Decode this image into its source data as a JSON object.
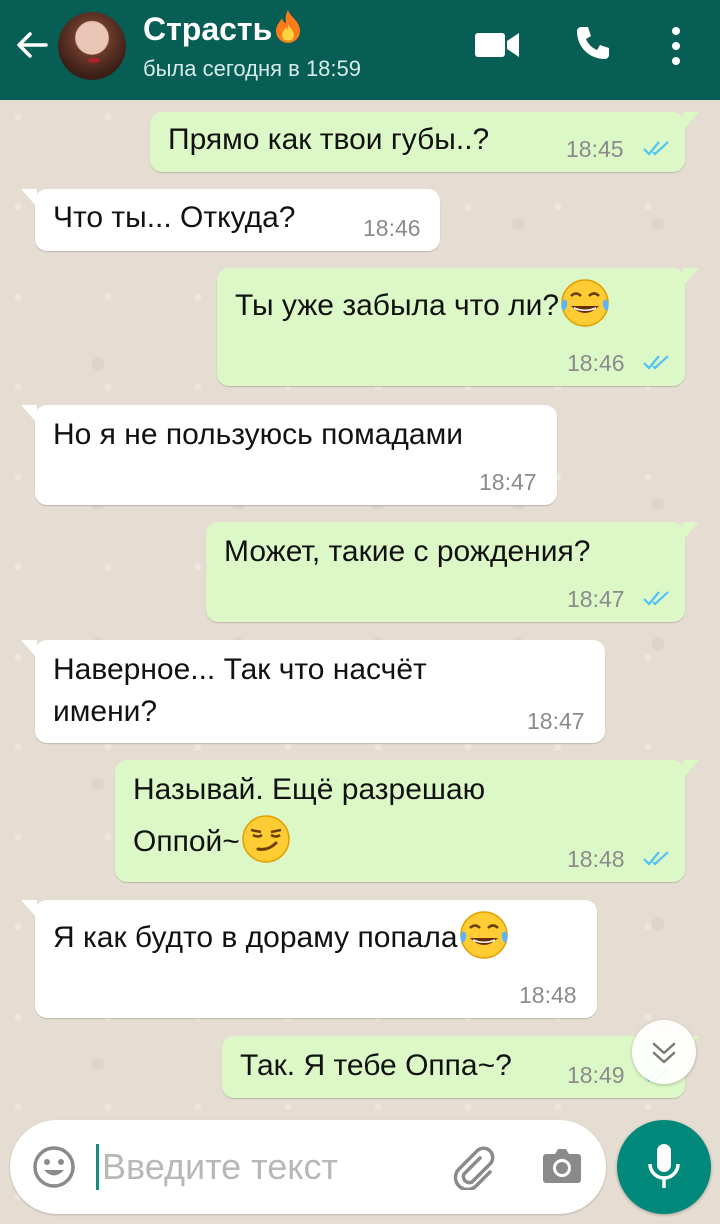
{
  "header": {
    "title": "Страсть",
    "title_emoji": "fire-emoji",
    "subtitle": "была сегодня в 18:59"
  },
  "messages": [
    {
      "direction": "out",
      "lines": [
        "Прямо как твои губы..?"
      ],
      "time": "18:45",
      "status": "read"
    },
    {
      "direction": "in",
      "lines": [
        "Что ты... Откуда?"
      ],
      "time": "18:46"
    },
    {
      "direction": "out",
      "lines": [
        "Ты уже забыла что ли?"
      ],
      "emoji": "tears-of-joy-emoji",
      "time": "18:46",
      "status": "read"
    },
    {
      "direction": "in",
      "lines": [
        "Но я не пользуюсь помадами"
      ],
      "time": "18:47"
    },
    {
      "direction": "out",
      "lines": [
        "Может, такие с рождения?"
      ],
      "time": "18:47",
      "status": "read"
    },
    {
      "direction": "in",
      "lines": [
        "Наверное... Так что насчёт",
        "имени?"
      ],
      "time": "18:47"
    },
    {
      "direction": "out",
      "lines": [
        "Называй. Ещё разрешаю",
        "Оппой~"
      ],
      "emoji": "smirk-emoji",
      "time": "18:48",
      "status": "read"
    },
    {
      "direction": "in",
      "lines": [
        "Я как будто в дораму попала"
      ],
      "emoji": "tears-of-joy-emoji",
      "time": "18:48"
    },
    {
      "direction": "out",
      "lines": [
        "Так. Я тебе Оппа~?"
      ],
      "time": "18:49",
      "status": "read"
    }
  ],
  "composer": {
    "placeholder": "Введите текст"
  },
  "colors": {
    "header": "#075e54",
    "outgoing_bubble": "#dcf8c6",
    "incoming_bubble": "#ffffff",
    "read_ticks": "#4fc3f7",
    "mic_button": "#00897b"
  }
}
